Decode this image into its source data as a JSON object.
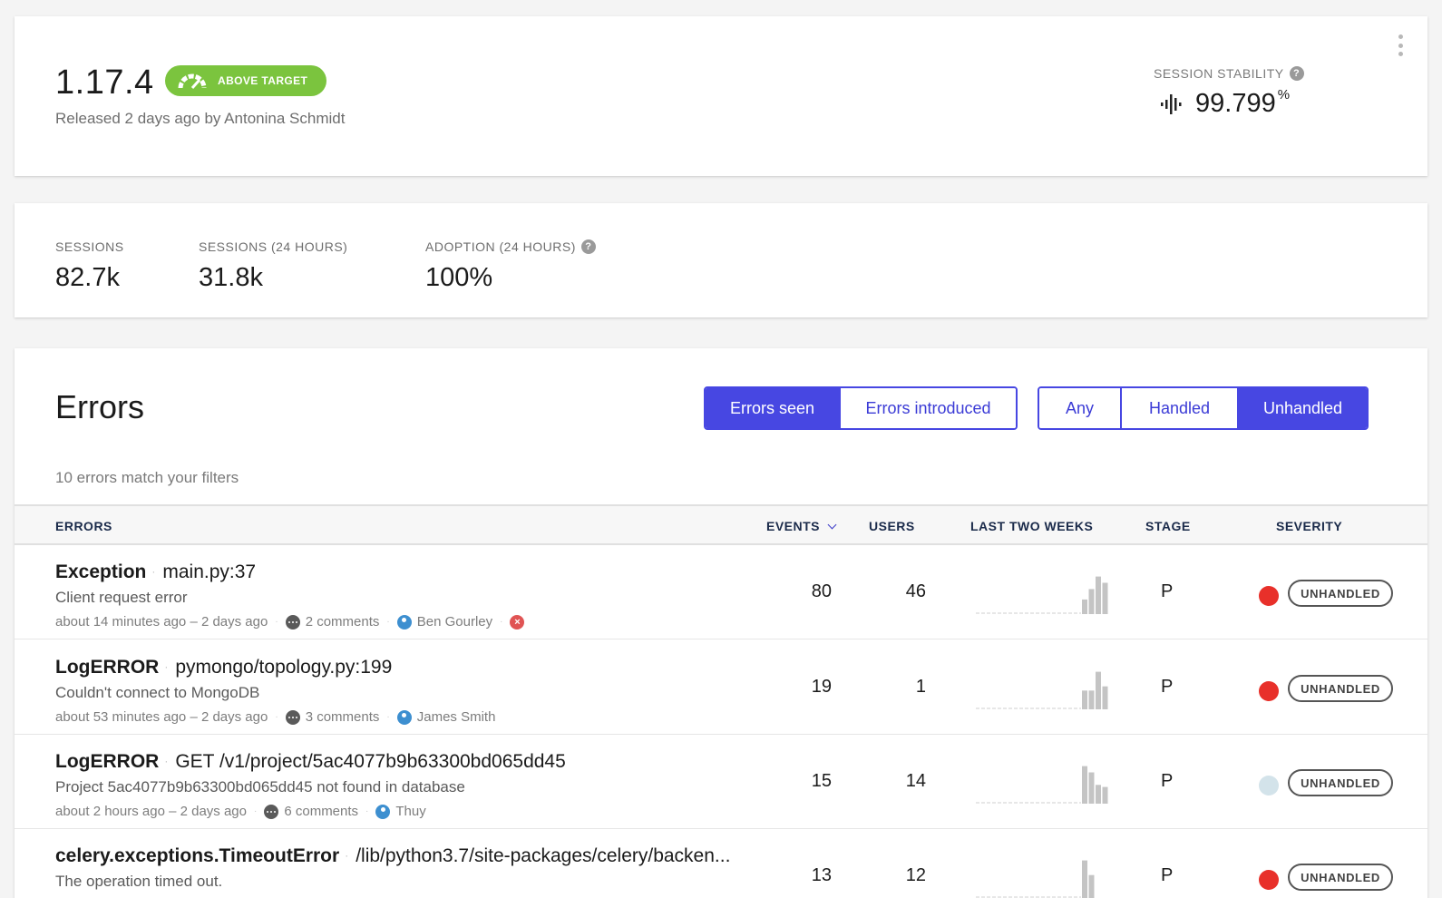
{
  "release": {
    "version": "1.17.4",
    "badge": "ABOVE TARGET",
    "released": "Released 2 days ago by Antonina Schmidt",
    "stability_label": "SESSION STABILITY",
    "stability_value": "99.799",
    "stability_unit": "%"
  },
  "metrics": [
    {
      "label": "SESSIONS",
      "value": "82.7k"
    },
    {
      "label": "SESSIONS (24 HOURS)",
      "value": "31.8k"
    },
    {
      "label": "ADOPTION (24 HOURS)",
      "value": "100%"
    }
  ],
  "errors": {
    "title": "Errors",
    "seen_toggle": [
      "Errors seen",
      "Errors introduced"
    ],
    "handled_toggle": [
      "Any",
      "Handled",
      "Unhandled"
    ],
    "match_text": "10 errors match your filters",
    "columns": {
      "errors": "ERRORS",
      "events": "EVENTS",
      "users": "USERS",
      "last_two_weeks": "LAST TWO WEEKS",
      "stage": "STAGE",
      "severity": "SEVERITY"
    },
    "rows": [
      {
        "type": "Exception",
        "location": "main.py:37",
        "message": "Client request error",
        "time": "about 14 minutes ago – 2 days ago",
        "comments": "2 comments",
        "assignee": "Ben Gourley",
        "events": "80",
        "users": "46",
        "stage": "P",
        "severity_color": "#e8302a",
        "severity": "UNHANDLED",
        "spark": [
          0.35,
          0.6,
          0.9,
          0.75
        ]
      },
      {
        "type": "LogERROR",
        "location": "pymongo/topology.py:199",
        "message": "Couldn't connect to MongoDB",
        "time": "about 53 minutes ago – 2 days ago",
        "comments": "3 comments",
        "assignee": "James Smith",
        "events": "19",
        "users": "1",
        "stage": "P",
        "severity_color": "#e8302a",
        "severity": "UNHANDLED",
        "spark": [
          0.45,
          0.45,
          0.9,
          0.55
        ]
      },
      {
        "type": "LogERROR",
        "location": "GET /v1/project/5ac4077b9b63300bd065dd45",
        "message": "Project 5ac4077b9b63300bd065dd45 not found in database",
        "time": "about 2 hours ago – 2 days ago",
        "comments": "6 comments",
        "assignee": "Thuy",
        "events": "15",
        "users": "14",
        "stage": "P",
        "severity_color": "#d3e3ea",
        "severity": "UNHANDLED",
        "spark": [
          0.9,
          0.75,
          0.45,
          0.4
        ]
      },
      {
        "type": "celery.exceptions.TimeoutError",
        "location": "/lib/python3.7/site-packages/celery/backen...",
        "message": "The operation timed out.",
        "events": "13",
        "users": "12",
        "stage": "P",
        "severity_color": "#e8302a",
        "severity": "UNHANDLED",
        "spark": [
          0.9,
          0.55
        ]
      }
    ]
  },
  "colors": {
    "accent": "#4747e2",
    "badge_green": "#7bc43e"
  }
}
